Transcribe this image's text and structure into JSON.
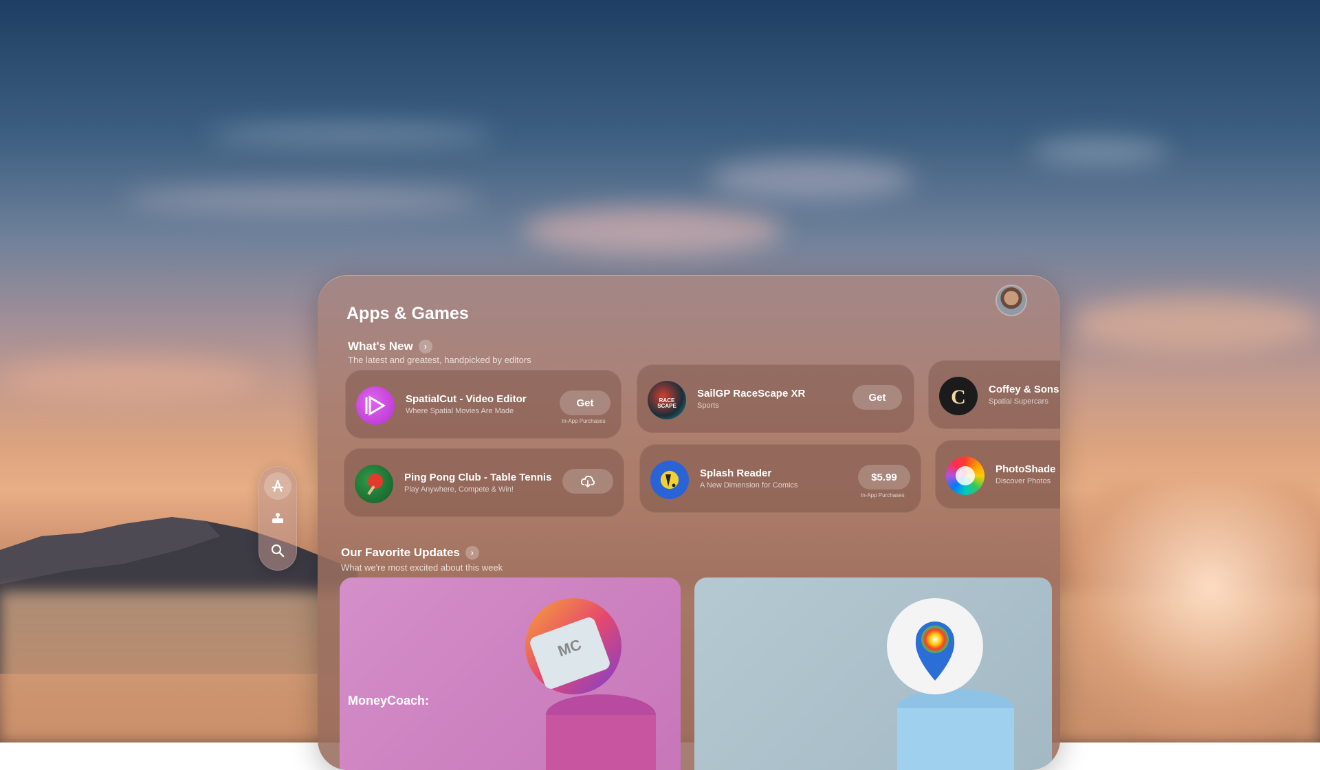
{
  "app": {
    "title": "Apps & Games"
  },
  "ornament": {
    "items": [
      {
        "icon": "apps-icon",
        "active": true
      },
      {
        "icon": "arcade-icon",
        "active": false
      },
      {
        "icon": "search-icon",
        "active": false
      }
    ]
  },
  "whats_new": {
    "title": "What's New",
    "subtitle": "The latest and greatest, handpicked by editors"
  },
  "apps": [
    {
      "name": "SpatialCut - Video Editor",
      "subtitle": "Where Spatial Movies Are Made",
      "button": "Get",
      "iap": "In-App Purchases",
      "icon_color": "#c23bd8"
    },
    {
      "name": "SailGP RaceScape XR",
      "subtitle": "Sports",
      "button": "Get",
      "iap": "",
      "icon_color": "#1e3b4c"
    },
    {
      "name": "Coffey & Sons",
      "subtitle": "Spatial Supercars",
      "button": "",
      "iap": "",
      "icon_color": "#1a1a1a"
    },
    {
      "name": "Ping Pong Club - Table Tennis",
      "subtitle": "Play Anywhere, Compete & Win!",
      "button": "",
      "iap": "",
      "icon_color": "#1c7b34"
    },
    {
      "name": "Splash Reader",
      "subtitle": "A New Dimension for Comics",
      "button": "$5.99",
      "iap": "In-App Purchases",
      "icon_color": "#2a63d6"
    },
    {
      "name": "PhotoShade",
      "subtitle": "Discover Photos",
      "button": "",
      "iap": "",
      "icon_color": "#e04a8c"
    }
  ],
  "favorite_updates": {
    "title": "Our Favorite Updates",
    "subtitle": "What we're most excited about this week",
    "cards": [
      {
        "label": "MoneyCoach:",
        "bg": "#d38ac7"
      },
      {
        "label": "",
        "bg": "#a8bfc9"
      }
    ]
  }
}
